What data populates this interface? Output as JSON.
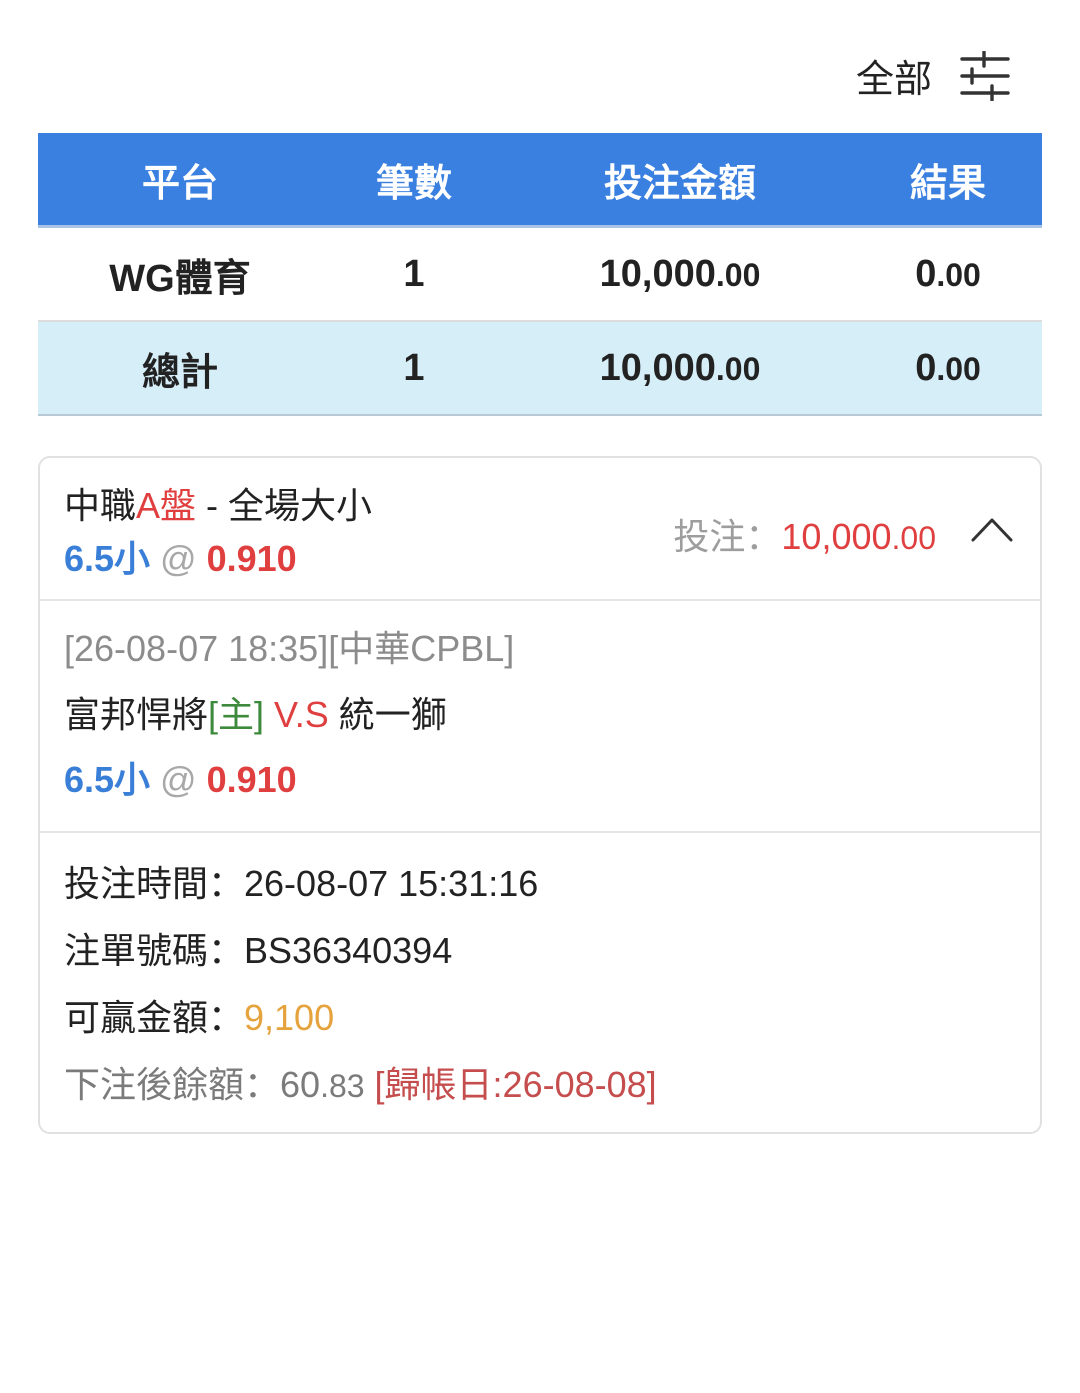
{
  "filter": {
    "label": "全部",
    "icon": "filter-sliders-icon"
  },
  "summary": {
    "headers": [
      "平台",
      "筆數",
      "投注金額",
      "結果"
    ],
    "rows": [
      {
        "platform": "WG體育",
        "count": "1",
        "amount_int": "10,000",
        "amount_dec": ".00",
        "result_int": "0",
        "result_dec": ".00"
      }
    ],
    "total": {
      "platform": "總計",
      "count": "1",
      "amount_int": "10,000",
      "amount_dec": ".00",
      "result_int": "0",
      "result_dec": ".00"
    }
  },
  "bet": {
    "league": "中職",
    "market_tag": "A盤",
    "market_name": " - 全場大小",
    "pick": "6.5小",
    "at": " @ ",
    "odds": "0.910",
    "stake_label": "投注：",
    "stake_int": "10,000",
    "stake_dec": ".00",
    "collapse_icon": "chevron-up-icon",
    "match_meta": "[26-08-07 18:35][中華CPBL]",
    "home_team": "富邦悍將",
    "home_tag": "[主]",
    "vs": " V.S ",
    "away_team": "統一獅",
    "bet_time_label": "投注時間：",
    "bet_time": "26-08-07 15:31:16",
    "ticket_label": "注單號碼：",
    "ticket_no": "BS36340394",
    "win_label": "可贏金額：",
    "win_amount": "9,100",
    "balance_label": "下注後餘額：",
    "balance_int": "60",
    "balance_dec": ".83",
    "settle": " [歸帳日:26-08-08]"
  }
}
